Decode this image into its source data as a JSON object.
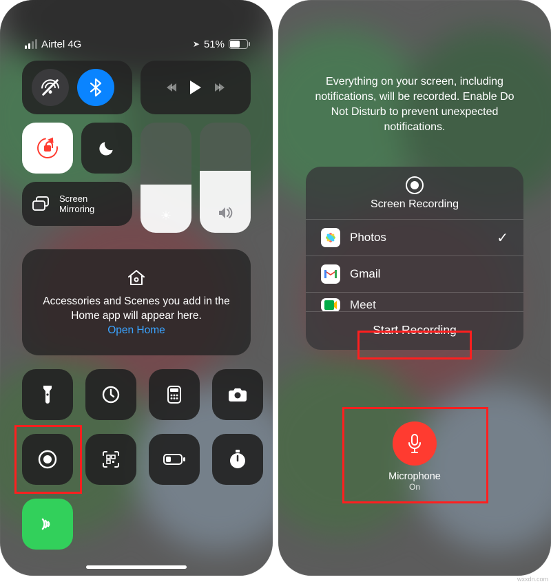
{
  "left": {
    "carrier": "Airtel 4G",
    "battery_pct": "51%",
    "screen_mirroring": "Screen\nMirroring",
    "home_text": "Accessories and Scenes you add in the Home app will appear here.",
    "open_home": "Open Home"
  },
  "right": {
    "notice": "Everything on your screen, including notifications, will be recorded. Enable Do Not Disturb to prevent unexpected notifications.",
    "title": "Screen Recording",
    "apps": [
      "Photos",
      "Gmail",
      "Meet"
    ],
    "start": "Start Recording",
    "mic_label": "Microphone",
    "mic_state": "On"
  },
  "watermark": "wxxdn.com"
}
